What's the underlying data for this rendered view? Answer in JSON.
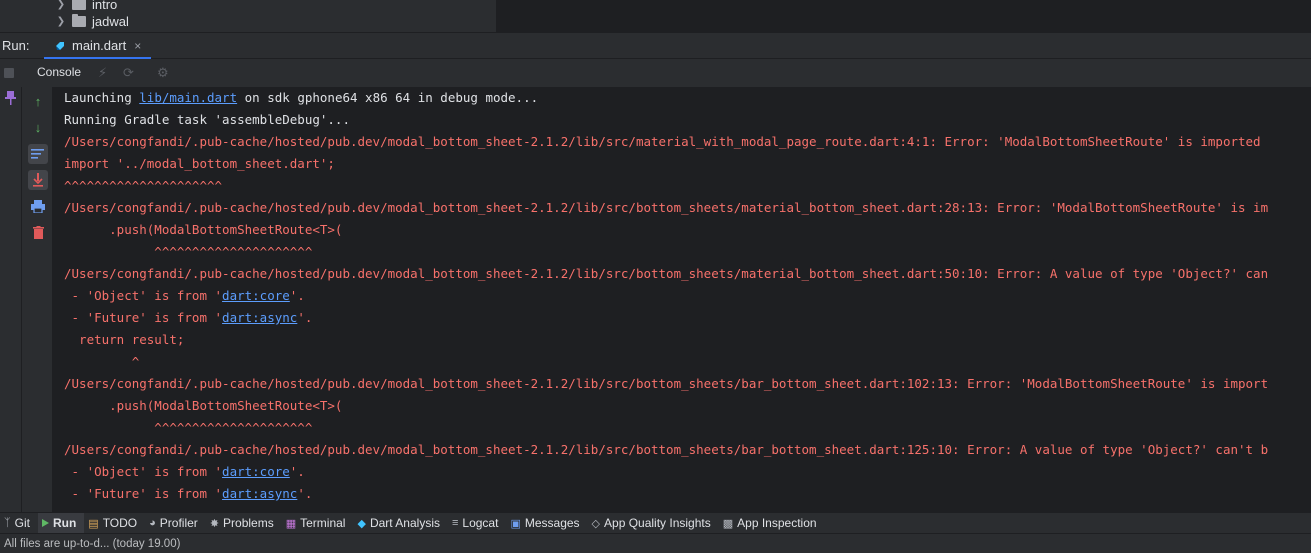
{
  "project_tree": {
    "items": [
      {
        "label": "intro"
      },
      {
        "label": "jadwal"
      }
    ]
  },
  "run_bar": {
    "label": "Run:",
    "tab": {
      "label": "main.dart",
      "close": "×"
    }
  },
  "console_toolbar": {
    "tab": "Console"
  },
  "console": {
    "lines": [
      {
        "segments": [
          {
            "t": "Launching ",
            "c": "norm"
          },
          {
            "t": "lib/main.dart",
            "c": "lnk"
          },
          {
            "t": " on sdk gphone64 x86 64 in debug mode...",
            "c": "norm"
          }
        ]
      },
      {
        "segments": [
          {
            "t": "Running Gradle task 'assembleDebug'...",
            "c": "norm"
          }
        ]
      },
      {
        "segments": [
          {
            "t": "/Users/congfandi/.pub-cache/hosted/pub.dev/modal_bottom_sheet-2.1.2/lib/src/material_with_modal_page_route.dart:4:1: Error: 'ModalBottomSheetRoute' is imported",
            "c": "err"
          }
        ]
      },
      {
        "segments": [
          {
            "t": "import '../modal_bottom_sheet.dart';",
            "c": "err"
          }
        ]
      },
      {
        "segments": [
          {
            "t": "^^^^^^^^^^^^^^^^^^^^^",
            "c": "err"
          }
        ]
      },
      {
        "segments": [
          {
            "t": "/Users/congfandi/.pub-cache/hosted/pub.dev/modal_bottom_sheet-2.1.2/lib/src/bottom_sheets/material_bottom_sheet.dart:28:13: Error: 'ModalBottomSheetRoute' is im",
            "c": "err"
          }
        ]
      },
      {
        "segments": [
          {
            "t": "      .push(ModalBottomSheetRoute<T>(",
            "c": "err"
          }
        ]
      },
      {
        "segments": [
          {
            "t": "            ^^^^^^^^^^^^^^^^^^^^^",
            "c": "err"
          }
        ]
      },
      {
        "segments": [
          {
            "t": "/Users/congfandi/.pub-cache/hosted/pub.dev/modal_bottom_sheet-2.1.2/lib/src/bottom_sheets/material_bottom_sheet.dart:50:10: Error: A value of type 'Object?' can",
            "c": "err"
          }
        ]
      },
      {
        "segments": [
          {
            "t": " - 'Object' is from '",
            "c": "err"
          },
          {
            "t": "dart:core",
            "c": "lnk"
          },
          {
            "t": "'.",
            "c": "err"
          }
        ]
      },
      {
        "segments": [
          {
            "t": " - 'Future' is from '",
            "c": "err"
          },
          {
            "t": "dart:async",
            "c": "lnk"
          },
          {
            "t": "'.",
            "c": "err"
          }
        ]
      },
      {
        "segments": [
          {
            "t": "  return result;",
            "c": "err"
          }
        ]
      },
      {
        "segments": [
          {
            "t": "         ^",
            "c": "err"
          }
        ]
      },
      {
        "segments": [
          {
            "t": "/Users/congfandi/.pub-cache/hosted/pub.dev/modal_bottom_sheet-2.1.2/lib/src/bottom_sheets/bar_bottom_sheet.dart:102:13: Error: 'ModalBottomSheetRoute' is import",
            "c": "err"
          }
        ]
      },
      {
        "segments": [
          {
            "t": "      .push(ModalBottomSheetRoute<T>(",
            "c": "err"
          }
        ]
      },
      {
        "segments": [
          {
            "t": "            ^^^^^^^^^^^^^^^^^^^^^",
            "c": "err"
          }
        ]
      },
      {
        "segments": [
          {
            "t": "/Users/congfandi/.pub-cache/hosted/pub.dev/modal_bottom_sheet-2.1.2/lib/src/bottom_sheets/bar_bottom_sheet.dart:125:10: Error: A value of type 'Object?' can't b",
            "c": "err"
          }
        ]
      },
      {
        "segments": [
          {
            "t": " - 'Object' is from '",
            "c": "err"
          },
          {
            "t": "dart:core",
            "c": "lnk"
          },
          {
            "t": "'.",
            "c": "err"
          }
        ]
      },
      {
        "segments": [
          {
            "t": " - 'Future' is from '",
            "c": "err"
          },
          {
            "t": "dart:async",
            "c": "lnk"
          },
          {
            "t": "'.",
            "c": "err"
          }
        ]
      }
    ]
  },
  "tool_windows": [
    {
      "id": "git",
      "label": "Git",
      "icon": "git-branch-icon"
    },
    {
      "id": "run",
      "label": "Run",
      "icon": "play-icon",
      "active": true
    },
    {
      "id": "todo",
      "label": "TODO",
      "icon": "todo-list-icon"
    },
    {
      "id": "profiler",
      "label": "Profiler",
      "icon": "gauge-icon"
    },
    {
      "id": "problems",
      "label": "Problems",
      "icon": "bug-icon"
    },
    {
      "id": "terminal",
      "label": "Terminal",
      "icon": "terminal-icon"
    },
    {
      "id": "dart-analysis",
      "label": "Dart Analysis",
      "icon": "dart-icon"
    },
    {
      "id": "logcat",
      "label": "Logcat",
      "icon": "logcat-icon"
    },
    {
      "id": "messages",
      "label": "Messages",
      "icon": "message-icon"
    },
    {
      "id": "app-quality-insights",
      "label": "App Quality Insights",
      "icon": "diamond-icon"
    },
    {
      "id": "app-inspection",
      "label": "App Inspection",
      "icon": "android-icon"
    }
  ],
  "status": {
    "text": "All files are up-to-d... (today 19.00)"
  },
  "colors": {
    "error": "#f7716b",
    "link": "#5c9dfd",
    "accent": "#3574f0",
    "run_green": "#5fb865"
  }
}
